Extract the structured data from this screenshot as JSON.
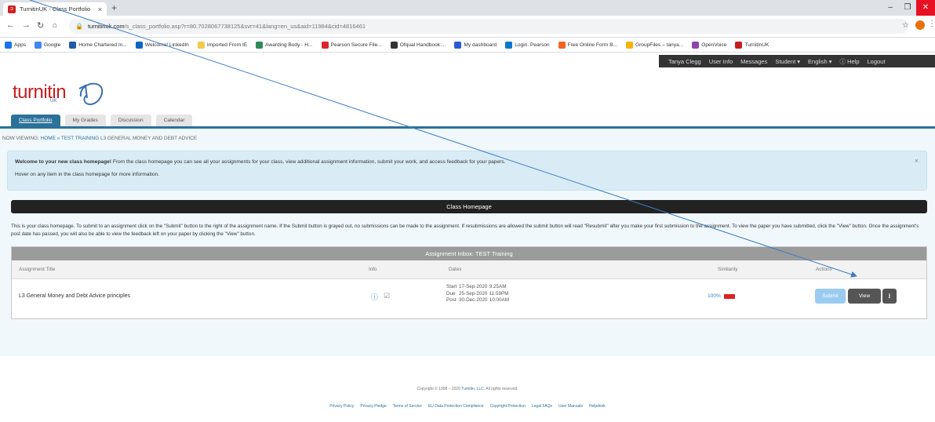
{
  "browser": {
    "tab_title": "TurnitinUK - Class Portfolio",
    "tab_close": "×",
    "new_tab": "+",
    "url_host": "turnitinuk.com",
    "url_path": "/s_class_portfolio.asp?r=80.7028067738125&svr=41&lang=en_us&aid=11984&cid=4816461",
    "window_controls": [
      "–",
      "❐",
      "✕"
    ],
    "bookmarks": [
      {
        "label": "Apps",
        "color": "#1a73e8"
      },
      {
        "label": "Google",
        "color": "#4285f4"
      },
      {
        "label": "Home Chartered In...",
        "color": "#1e5aa8"
      },
      {
        "label": "Welcome! LinkedIn",
        "color": "#0a66c2"
      },
      {
        "label": "Imported From IE",
        "color": "#f2c94c"
      },
      {
        "label": "Awarding Body - H...",
        "color": "#2e8b57"
      },
      {
        "label": "Pearson Secure File...",
        "color": "#d9272e"
      },
      {
        "label": "Ofqual Handbook:...",
        "color": "#333333"
      },
      {
        "label": "My dashboard",
        "color": "#2a5bd7"
      },
      {
        "label": "Login. Pearson",
        "color": "#0077c8"
      },
      {
        "label": "Free Online Form B...",
        "color": "#f26522"
      },
      {
        "label": "GroupFiles – tanya...",
        "color": "#f4b400"
      },
      {
        "label": "OpenVoice",
        "color": "#8e44ad"
      },
      {
        "label": "TurnitinUK",
        "color": "#c41e1e"
      }
    ]
  },
  "topnav": {
    "items": [
      "Tanya Clegg",
      "User Info",
      "Messages",
      "Student ▾",
      "English ▾",
      "ⓘ Help",
      "Logout"
    ]
  },
  "logo": {
    "text": "turnitin",
    "sub": "UK"
  },
  "class_tabs": [
    "Class Portfolio",
    "My Grades",
    "Discussion",
    "Calendar"
  ],
  "breadcrumb": {
    "prefix": "NOW VIEWING:",
    "links": "HOME » TEST TRAINING",
    "current": "L3 GENERAL MONEY AND DEBT ADVICE"
  },
  "welcome": {
    "bold": "Welcome to your new class homepage!",
    "line1": " From the class homepage you can see all your assignments for your class, view additional assignment information, submit your work, and access feedback for your papers.",
    "line2": "Hover on any item in the class homepage for more information.",
    "close": "×"
  },
  "home_header": "Class Homepage",
  "instructions": "This is your class homepage. To submit to an assignment click on the \"Submit\" button to the right of the assignment name. If the Submit button is grayed out, no submissions can be made to the assignment. If resubmissions are allowed the submit button will read \"Resubmit\" after you make your first submission to the assignment. To view the paper you have submitted, click the \"View\" button. Once the assignment's post date has passed, you will also be able to view the feedback left on your paper by clicking the \"View\" button.",
  "inbox": {
    "title": "Assignment Inbox: TEST Training",
    "columns": {
      "title": "Assignment Title",
      "info": "Info",
      "dates": "Dates",
      "similarity": "Similarity",
      "actions": "Actions"
    },
    "row": {
      "title": "L3 General Money and Debt Advice principles",
      "dates": [
        {
          "label": "Start",
          "date": "17-Sep-2020",
          "time": "9:25AM"
        },
        {
          "label": "Due",
          "date": "25-Sep-2020",
          "time": "11:59PM"
        },
        {
          "label": "Post",
          "date": "30-Dec-2020",
          "time": "10:00AM"
        }
      ],
      "similarity": "100%",
      "submit_label": "Submit",
      "view_label": "View"
    }
  },
  "footer": {
    "copyright_pre": "Copyright © 1998 – 2020 ",
    "copyright_link": "Turnitin, LLC.",
    "copyright_post": " All rights reserved.",
    "links": [
      "Privacy Policy",
      "Privacy Pledge",
      "Terms of Service",
      "EU Data Protection Compliance",
      "Copyright Protection",
      "Legal FAQs",
      "User Manuals",
      "Helpdesk"
    ]
  }
}
